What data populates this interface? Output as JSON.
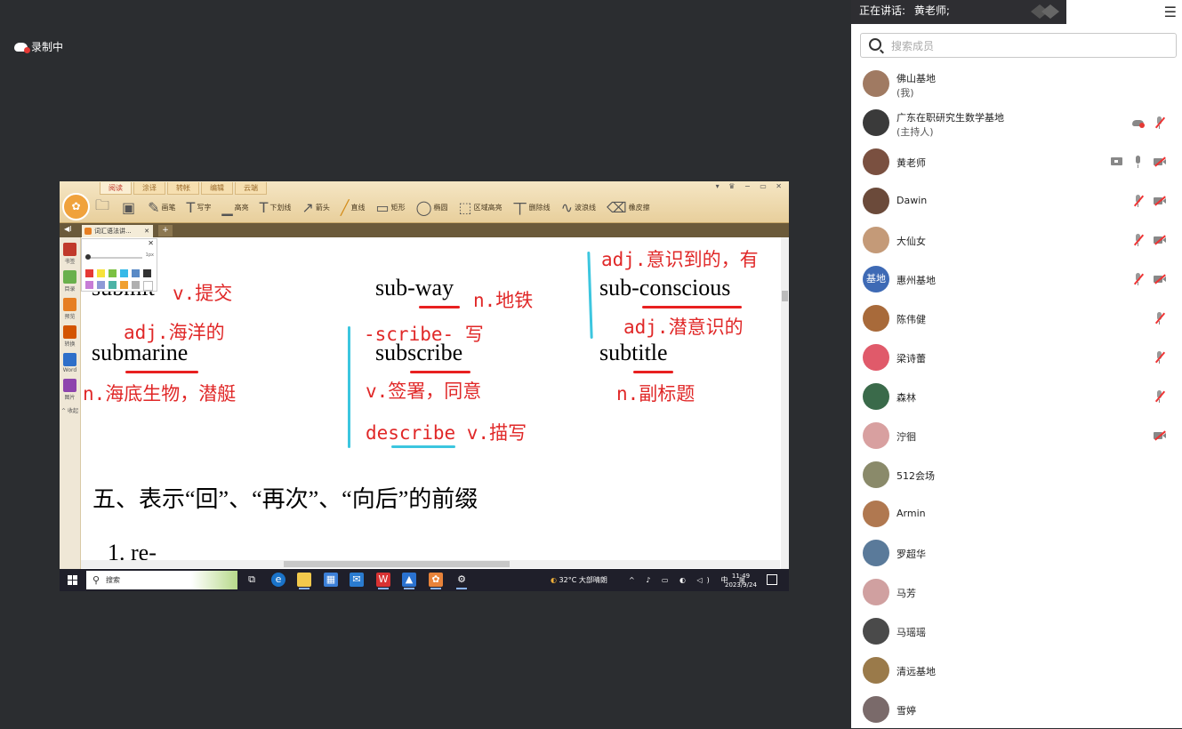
{
  "recording": {
    "label": "录制中"
  },
  "panel": {
    "speaking_prefix": "正在讲话:",
    "speaking_name": "黄老师;",
    "search_placeholder": "搜索成员",
    "members": [
      {
        "name": "佛山基地",
        "role": "(我)",
        "avatar_color": "#a07a62",
        "icons": []
      },
      {
        "name": "广东在职研究生数学基地",
        "role": "(主持人)",
        "avatar_color": "#3a3a3a",
        "icons": [
          "cloud",
          "mic-off"
        ]
      },
      {
        "name": "黄老师",
        "role": "",
        "avatar_color": "#7a5040",
        "icons": [
          "screen",
          "mic",
          "cam-off"
        ]
      },
      {
        "name": "Dawin",
        "role": "",
        "avatar_color": "#6b4a3a",
        "icons": [
          "mic-off",
          "cam-off"
        ]
      },
      {
        "name": "大仙女",
        "role": "",
        "avatar_color": "#c49a78",
        "icons": [
          "mic-off",
          "cam-off"
        ]
      },
      {
        "name": "惠州基地",
        "role": "",
        "avatar_color": "#3e6ab5",
        "avatar_text": "基地",
        "icons": [
          "mic-off",
          "cam-off"
        ]
      },
      {
        "name": "陈伟健",
        "role": "",
        "avatar_color": "#a86a3a",
        "icons": [
          "mic-off"
        ]
      },
      {
        "name": "梁诗蕾",
        "role": "",
        "avatar_color": "#e05a6a",
        "icons": [
          "mic-off"
        ]
      },
      {
        "name": "森林",
        "role": "",
        "avatar_color": "#3a6a4a",
        "icons": [
          "mic-off"
        ]
      },
      {
        "name": "泞徊",
        "role": "",
        "avatar_color": "#d8a0a0",
        "icons": [
          "cam-off"
        ]
      },
      {
        "name": "512会场",
        "role": "",
        "avatar_color": "#8a8a6a",
        "icons": []
      },
      {
        "name": "Armin",
        "role": "",
        "avatar_color": "#b07850",
        "icons": []
      },
      {
        "name": "罗超华",
        "role": "",
        "avatar_color": "#5a7a9a",
        "icons": []
      },
      {
        "name": "马芳",
        "role": "",
        "avatar_color": "#d0a0a0",
        "icons": []
      },
      {
        "name": "马瑶瑶",
        "role": "",
        "avatar_color": "#4a4a4a",
        "icons": []
      },
      {
        "name": "清远基地",
        "role": "",
        "avatar_color": "#9a7a4a",
        "icons": []
      },
      {
        "name": "雪婷",
        "role": "",
        "avatar_color": "#7a6a6a",
        "icons": []
      }
    ]
  },
  "app": {
    "menu_tabs": [
      "阅读",
      "涂译",
      "转帐",
      "编辑",
      "云端"
    ],
    "active_tab": 0,
    "window_controls": "▾ ♛ − ▭ ✕",
    "tools": [
      {
        "label": "画笔",
        "icon": "pen-icon",
        "glyph": "✎"
      },
      {
        "label": "写字",
        "icon": "text-icon",
        "glyph": "T"
      },
      {
        "label": "高亮",
        "icon": "highlight-icon",
        "glyph": "▁"
      },
      {
        "label": "下划线",
        "icon": "underline-icon",
        "glyph": "T"
      },
      {
        "label": "箭头",
        "icon": "arrow-icon",
        "glyph": "↗"
      },
      {
        "label": "直线",
        "icon": "line-icon",
        "glyph": "╱"
      },
      {
        "label": "矩形",
        "icon": "rect-icon",
        "glyph": "▭"
      },
      {
        "label": "椭圆",
        "icon": "ellipse-icon",
        "glyph": "◯"
      },
      {
        "label": "区域高亮",
        "icon": "area-highlight-icon",
        "glyph": "⬚"
      },
      {
        "label": "删除线",
        "icon": "strike-icon",
        "glyph": "丅"
      },
      {
        "label": "波浪线",
        "icon": "wave-icon",
        "glyph": "∿"
      },
      {
        "label": "橡皮擦",
        "icon": "eraser-icon",
        "glyph": "⌫"
      }
    ],
    "selected_tool": 5,
    "doc_tab": "词汇语法讲...",
    "doc_tab_close": "✕",
    "tab_add": "+",
    "tab_collapse": "◀I",
    "sidebar": [
      {
        "label": "书签",
        "color": "#c0392b"
      },
      {
        "label": "目录",
        "color": "#6ab04c"
      },
      {
        "label": "预览",
        "color": "#e67e22"
      },
      {
        "label": "转换",
        "color": "#d35400"
      },
      {
        "label": "Word",
        "color": "#2e6fc9"
      },
      {
        "label": "图片",
        "color": "#8e44ad"
      }
    ],
    "sidebar_more": "^ 收起",
    "palette": {
      "size_label": "1px",
      "close": "✕",
      "colors_row1": [
        "#e53935",
        "#f7e23b",
        "#7cc142",
        "#36b9e8",
        "#5a8ac6",
        "#333333"
      ],
      "colors_row2": [
        "#c77dd6",
        "#8e9ad6",
        "#4cb3a6",
        "#f0a030",
        "#b0b0b0",
        "#ffffff"
      ]
    }
  },
  "document": {
    "words": [
      {
        "text": "submit"
      },
      {
        "text": "sub-way"
      },
      {
        "text": "sub-conscious"
      },
      {
        "text": "submarine"
      },
      {
        "text": "subscribe"
      },
      {
        "text": "subtitle"
      }
    ],
    "annotations": [
      {
        "text": "v.提交"
      },
      {
        "text": "n.地铁"
      },
      {
        "text": "adj.意识到的，有"
      },
      {
        "text": "adj.海洋的"
      },
      {
        "text": "-scribe- 写"
      },
      {
        "text": "adj.潜意识的"
      },
      {
        "text": "n.海底生物，潜艇"
      },
      {
        "text": "v.签署，同意"
      },
      {
        "text": "n.副标题"
      },
      {
        "text": "describe v.描写"
      }
    ],
    "heading": "五、表示“回”、“再次”、“向后”的前缀",
    "item": "1. re-"
  },
  "taskbar": {
    "search_label": "搜索",
    "weather": "32°C  大部晴朗",
    "tray": "^ ♪ ▭ ◐ ◁) 中 ⊞",
    "time": "11:49",
    "date": "2023/9/24"
  }
}
